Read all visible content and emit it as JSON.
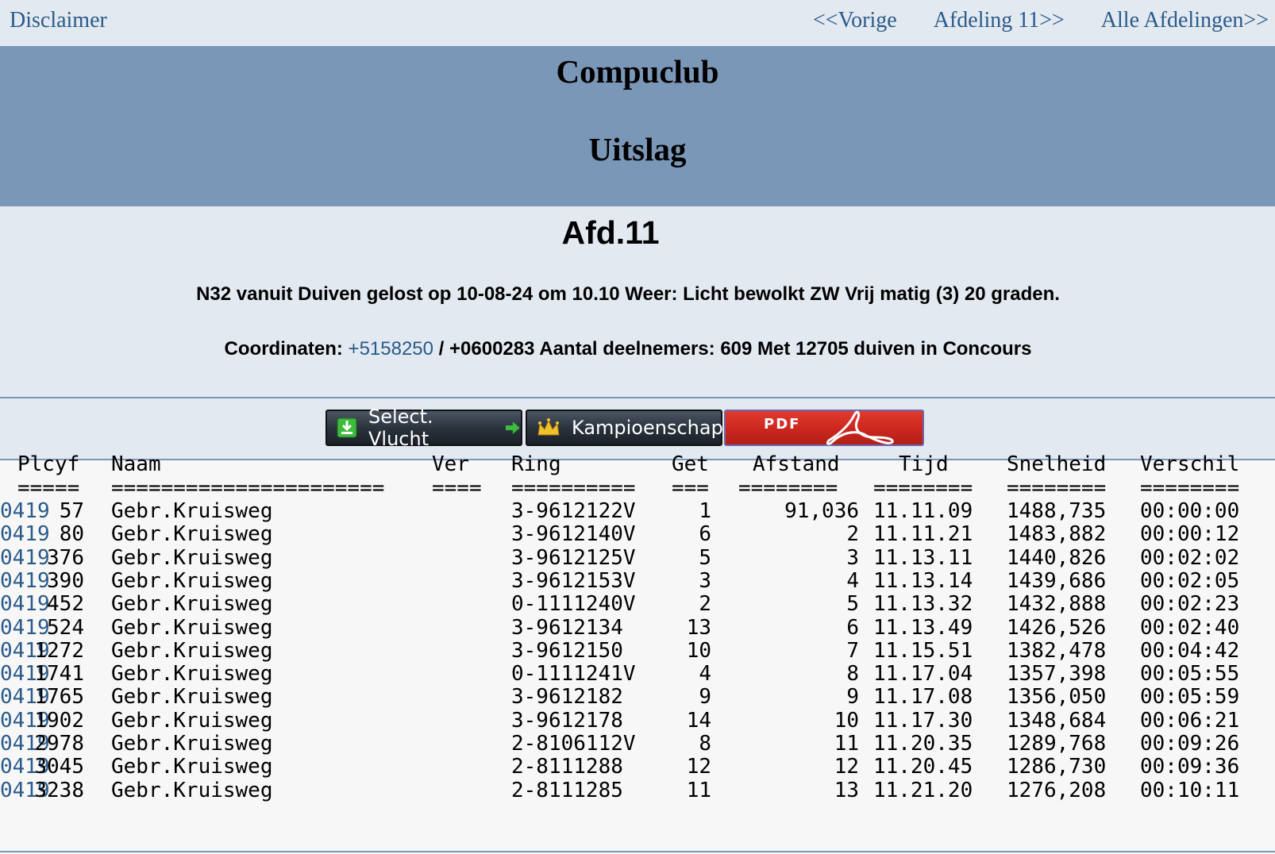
{
  "nav": {
    "disclaimer": "Disclaimer",
    "prev": "<<Vorige",
    "afdeling": "Afdeling 11>>",
    "alle": "Alle Afdelingen>>"
  },
  "banner": {
    "title": "Compuclub",
    "subtitle": "Uitslag"
  },
  "info": {
    "afdeling": "Afd.11",
    "flight_line": "N32 vanuit Duiven gelost op 10-08-24 om 10.10 Weer: Licht bewolkt ZW Vrij matig (3) 20 graden.",
    "coord_label": "Coordinaten:",
    "coord_link": "+5158250",
    "coord_rest": "/ +0600283 Aantal deelnemers: 609 Met 12705 duiven in Concours"
  },
  "buttons": {
    "select_vlucht": "Select. Vlucht",
    "kampioenschap": "Kampioenschap.",
    "pdf": "PDF"
  },
  "colors": {
    "link": "#2a5a8a",
    "banner": "#7b97b8",
    "panel": "#e3e9f0",
    "pdf_red": "#c7261d"
  },
  "table": {
    "headers": {
      "plcyf": "Plcyf",
      "naam": "Naam",
      "ver": "Ver",
      "ring": "Ring",
      "get": "Get",
      "afstand": "Afstand",
      "tijd": "Tijd",
      "snelheid": "Snelheid",
      "verschil": "Verschil"
    },
    "separators": {
      "plcyf": "=====",
      "naam": "======================",
      "ver": "====",
      "ring": "==========",
      "get": "===",
      "afstand": "========",
      "tijd": "========",
      "snelheid": "========",
      "verschil": "========"
    },
    "rows": [
      {
        "plcyf": "57",
        "naam": "Gebr.Kruisweg",
        "ver": "0419",
        "ring": "3-9612122V",
        "get": "1",
        "afstand": "91,036",
        "tijd": "11.11.09",
        "snelheid": "1488,735",
        "verschil": "00:00:00"
      },
      {
        "plcyf": "80",
        "naam": "Gebr.Kruisweg",
        "ver": "0419",
        "ring": "3-9612140V",
        "get": "6",
        "afstand": "2",
        "tijd": "11.11.21",
        "snelheid": "1483,882",
        "verschil": "00:00:12"
      },
      {
        "plcyf": "376",
        "naam": "Gebr.Kruisweg",
        "ver": "0419",
        "ring": "3-9612125V",
        "get": "5",
        "afstand": "3",
        "tijd": "11.13.11",
        "snelheid": "1440,826",
        "verschil": "00:02:02"
      },
      {
        "plcyf": "390",
        "naam": "Gebr.Kruisweg",
        "ver": "0419",
        "ring": "3-9612153V",
        "get": "3",
        "afstand": "4",
        "tijd": "11.13.14",
        "snelheid": "1439,686",
        "verschil": "00:02:05"
      },
      {
        "plcyf": "452",
        "naam": "Gebr.Kruisweg",
        "ver": "0419",
        "ring": "0-1111240V",
        "get": "2",
        "afstand": "5",
        "tijd": "11.13.32",
        "snelheid": "1432,888",
        "verschil": "00:02:23"
      },
      {
        "plcyf": "524",
        "naam": "Gebr.Kruisweg",
        "ver": "0419",
        "ring": "3-9612134",
        "get": "13",
        "afstand": "6",
        "tijd": "11.13.49",
        "snelheid": "1426,526",
        "verschil": "00:02:40"
      },
      {
        "plcyf": "1272",
        "naam": "Gebr.Kruisweg",
        "ver": "0419",
        "ring": "3-9612150",
        "get": "10",
        "afstand": "7",
        "tijd": "11.15.51",
        "snelheid": "1382,478",
        "verschil": "00:04:42"
      },
      {
        "plcyf": "1741",
        "naam": "Gebr.Kruisweg",
        "ver": "0419",
        "ring": "0-1111241V",
        "get": "4",
        "afstand": "8",
        "tijd": "11.17.04",
        "snelheid": "1357,398",
        "verschil": "00:05:55"
      },
      {
        "plcyf": "1765",
        "naam": "Gebr.Kruisweg",
        "ver": "0419",
        "ring": "3-9612182",
        "get": "9",
        "afstand": "9",
        "tijd": "11.17.08",
        "snelheid": "1356,050",
        "verschil": "00:05:59"
      },
      {
        "plcyf": "1902",
        "naam": "Gebr.Kruisweg",
        "ver": "0419",
        "ring": "3-9612178",
        "get": "14",
        "afstand": "10",
        "tijd": "11.17.30",
        "snelheid": "1348,684",
        "verschil": "00:06:21"
      },
      {
        "plcyf": "2978",
        "naam": "Gebr.Kruisweg",
        "ver": "0419",
        "ring": "2-8106112V",
        "get": "8",
        "afstand": "11",
        "tijd": "11.20.35",
        "snelheid": "1289,768",
        "verschil": "00:09:26"
      },
      {
        "plcyf": "3045",
        "naam": "Gebr.Kruisweg",
        "ver": "0419",
        "ring": "2-8111288",
        "get": "12",
        "afstand": "12",
        "tijd": "11.20.45",
        "snelheid": "1286,730",
        "verschil": "00:09:36"
      },
      {
        "plcyf": "3238",
        "naam": "Gebr.Kruisweg",
        "ver": "0419",
        "ring": "2-8111285",
        "get": "11",
        "afstand": "13",
        "tijd": "11.21.20",
        "snelheid": "1276,208",
        "verschil": "00:10:11"
      }
    ]
  }
}
